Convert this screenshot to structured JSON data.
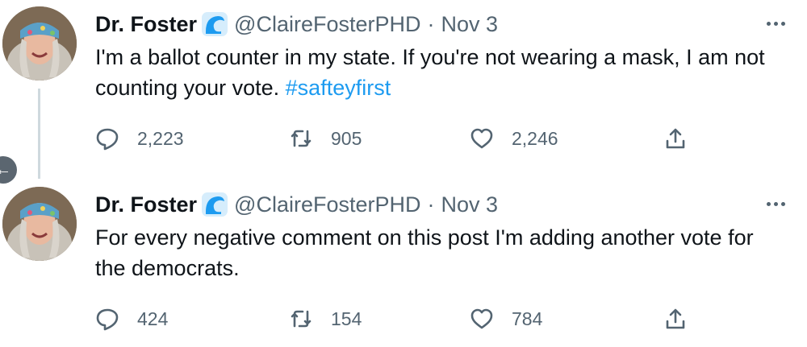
{
  "tweets": [
    {
      "author_name": "Dr. Foster",
      "handle": "@ClaireFosterPHD",
      "separator": "·",
      "date": "Nov 3",
      "text": "I'm a ballot counter in my state. If you're not wearing a mask, I am not counting your vote. ",
      "hashtag": "#safteyfirst",
      "replies": "2,223",
      "retweets": "905",
      "likes": "2,246"
    },
    {
      "author_name": "Dr. Foster",
      "handle": "@ClaireFosterPHD",
      "separator": "·",
      "date": "Nov 3",
      "text": "For every negative comment on this post I'm adding another vote for the democrats.",
      "hashtag": "",
      "replies": "424",
      "retweets": "154",
      "likes": "784"
    }
  ],
  "icons": {
    "badge": "wave-badge-icon",
    "reply": "reply-icon",
    "retweet": "retweet-icon",
    "like": "heart-icon",
    "share": "share-icon",
    "more": "more-icon",
    "back": "back-arrow-icon"
  },
  "colors": {
    "text": "#0f1419",
    "secondary": "#536471",
    "link": "#1d9bf0",
    "badge": "#1d9bf0"
  }
}
